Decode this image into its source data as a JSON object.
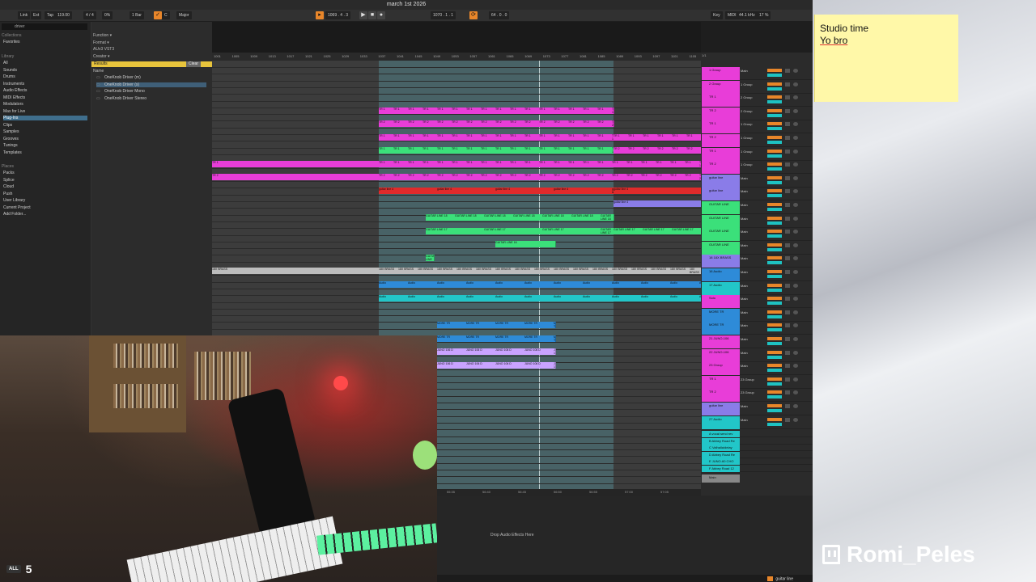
{
  "window": {
    "title": "march 1st 2026"
  },
  "transport": {
    "link": "Link",
    "ext": "Ext",
    "tap": "Tap",
    "tempo": "119.00",
    "sig": "4 / 4",
    "percent": "0%",
    "quant": "1 Bar",
    "key_label": "C",
    "scale": "Major",
    "position": "1069 .  4 .  3",
    "loop_start": "1070 .  1 .  1",
    "loop_len": "64 .  0 .  0",
    "key_btn": "Key",
    "midi_btn": "MIDI",
    "sample_rate": "44.1 kHz",
    "cpu": "17 %"
  },
  "browser": {
    "search": "driver",
    "collections_head": "Collections",
    "favorites": "Favorites",
    "library_head": "Library",
    "library_items": [
      "All",
      "Sounds",
      "Drums",
      "Instruments",
      "Audio Effects",
      "MIDI Effects",
      "Modulators",
      "Max for Live",
      "Plug-Ins",
      "Clips",
      "Samples",
      "Grooves",
      "Tunings",
      "Templates"
    ],
    "places_head": "Places",
    "places_items": [
      "Packs",
      "Splice",
      "Cloud",
      "Push",
      "User Library",
      "Current Project",
      "Add Folder..."
    ],
    "filters": [
      "Function ▾",
      "Format ▾",
      "AUv3   VST3",
      "Creator ▾"
    ],
    "results_label": "Results",
    "clear_label": "Clear",
    "name_header": "Name",
    "results": [
      "OneKnob Driver (m)",
      "OneKnob Driver (s)",
      "OneKnob Driver Mono",
      "OneKnob Driver Stereo"
    ]
  },
  "ruler": [
    "1001",
    "1005",
    "1009",
    "1013",
    "1017",
    "1021",
    "1025",
    "1029",
    "1033",
    "1037",
    "1041",
    "1045",
    "1049",
    "1053",
    "1057",
    "1061",
    "1065",
    "1069",
    "1073",
    "1077",
    "1081",
    "1085",
    "1089",
    "1093",
    "1097",
    "1101",
    "1105"
  ],
  "bottom_ruler": [
    "55:35",
    "56:40",
    "56:45",
    "56:50",
    "56:55",
    "57:00",
    "57:05"
  ],
  "clip_labels": [
    "TR 1",
    "TR 2",
    "GUITAR LINE 18",
    "GUITAR LINE 17",
    "GUITAR LINE 16",
    "GUITAR LINE 15",
    "18X BRASS",
    "Audio",
    "MORE TR",
    "JUNO 106 D",
    "guitar line 4"
  ],
  "tracks": [
    {
      "name": "1 Group",
      "route": "Main"
    },
    {
      "name": "2 Group",
      "route": "1 Group"
    },
    {
      "name": "TR 1",
      "route": "2 Group"
    },
    {
      "name": "TR 2",
      "route": "2 Group"
    },
    {
      "name": "TR 1",
      "route": "1 Group"
    },
    {
      "name": "TR 2",
      "route": "1 Group"
    },
    {
      "name": "TR 1",
      "route": "1 Group"
    },
    {
      "name": "TR 2",
      "route": "1 Group"
    },
    {
      "name": "guitar line",
      "route": "Main"
    },
    {
      "name": "guitar line",
      "route": "Main"
    },
    {
      "name": "GUITAR LINE",
      "route": "Main"
    },
    {
      "name": "GUITAR LINE",
      "route": "Main"
    },
    {
      "name": "GUITAR LINE",
      "route": "Main"
    },
    {
      "name": "GUITAR LINE",
      "route": "Main"
    },
    {
      "name": "18 18X BRASS",
      "route": "Main"
    },
    {
      "name": "16 Audio",
      "route": "Main"
    },
    {
      "name": "17 Audio",
      "route": "Main"
    },
    {
      "name": "Solo",
      "route": "Main"
    },
    {
      "name": "MORE TR",
      "route": "Main"
    },
    {
      "name": "MORE TR",
      "route": "Main"
    },
    {
      "name": "21 JUNO-106",
      "route": "Main"
    },
    {
      "name": "22 JUNO-106",
      "route": "Main"
    },
    {
      "name": "23 Group",
      "route": "Main"
    },
    {
      "name": "TR 1",
      "route": "23 Group"
    },
    {
      "name": "TR 2",
      "route": "23 Group"
    },
    {
      "name": "guitar line",
      "route": "Main"
    },
    {
      "name": "27 Audio",
      "route": "Main"
    }
  ],
  "returns": [
    "A vocal send rev",
    "B Abbey Road Re",
    "C Valhalla/delay",
    "D Abbey Road Re",
    "E JUNO-60 CHO",
    "F Abbey Road 12"
  ],
  "master_label": "Main",
  "loop_counter": "1/1",
  "device": {
    "drop_text": "Drop Audio Effects Here",
    "selected_track": "guitar line"
  },
  "sticky": {
    "line1": "Studio time",
    "line2": "Yo bro"
  },
  "stream": {
    "channel": "Romi_Peles",
    "cam_badge": "ALL",
    "cam_number": "5"
  },
  "colors": {
    "pink": "#e83dd8",
    "green": "#3be07a",
    "red": "#e02b2b",
    "cyan": "#22c6c8",
    "blue": "#2e8bd8",
    "purple": "#8a7ce8",
    "orange": "#e8862a"
  }
}
